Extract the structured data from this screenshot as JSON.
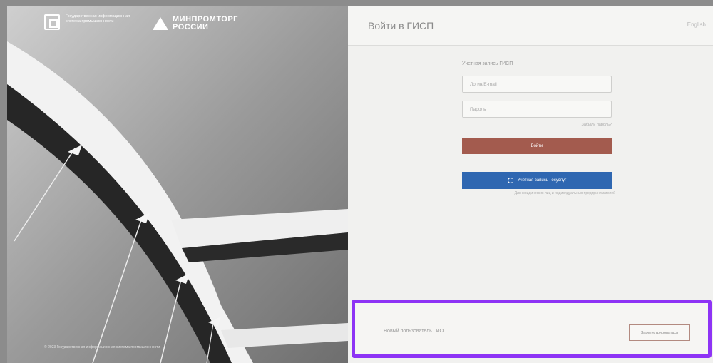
{
  "branding": {
    "gisp_text": "Государственная информационная система промышленности",
    "ministry_name_line1": "МИНПРОМТОРГ",
    "ministry_name_line2": "РОССИИ",
    "copyright": "© 2023 Государственная информационная система промышленности"
  },
  "header": {
    "title": "Войти в ГИСП",
    "lang": "English"
  },
  "form": {
    "section_label": "Учетная запись ГИСП",
    "login_placeholder": "Логин/E-mail",
    "password_placeholder": "Пароль",
    "forgot_link": "Забыли пароль?",
    "login_button": "Войти",
    "gosuslugi_button": "Учетная запись Госуслуг",
    "gosuslugi_note": "Для юридических лиц и индивидуальных предпринимателей"
  },
  "registration": {
    "prompt": "Новый пользователь ГИСП",
    "register_button": "Зарегистрироваться"
  },
  "colors": {
    "login_button": "#a35b4e",
    "gosuslugi_button": "#2f67b1",
    "highlight": "#8e33f5"
  }
}
